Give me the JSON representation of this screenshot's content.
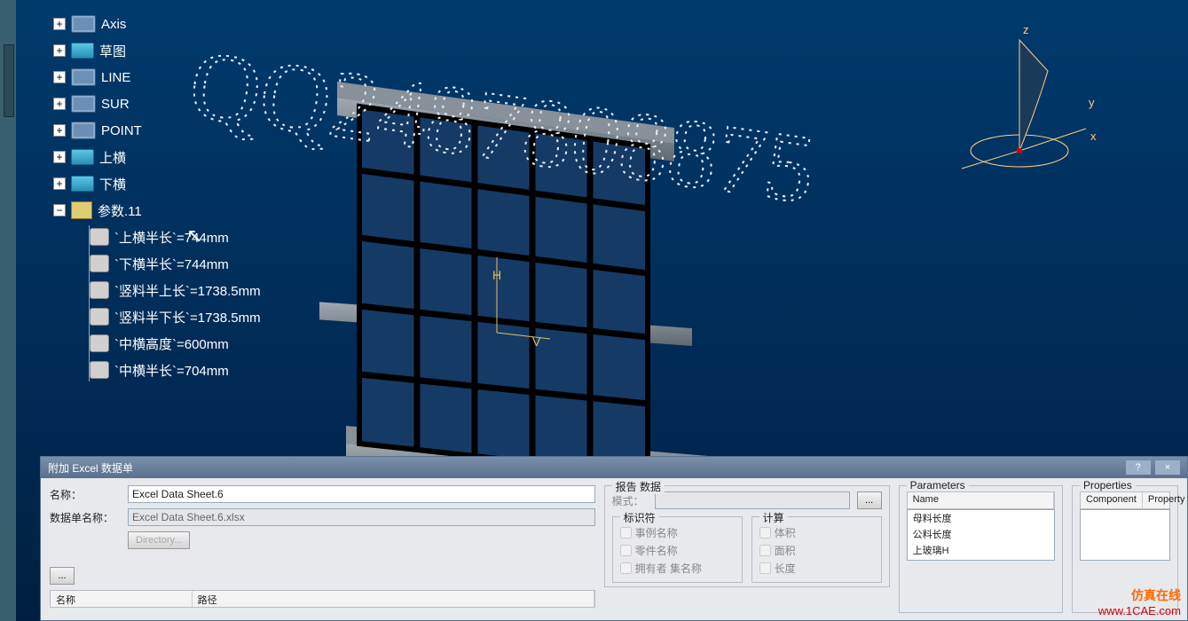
{
  "tree": {
    "items": [
      {
        "exp": "+",
        "icon": "cube",
        "label": "Axis"
      },
      {
        "exp": "+",
        "icon": "fold",
        "label": "草图"
      },
      {
        "exp": "+",
        "icon": "cube",
        "label": "LINE"
      },
      {
        "exp": "+",
        "icon": "cube",
        "label": "SUR"
      },
      {
        "exp": "+",
        "icon": "cube",
        "label": "POINT"
      },
      {
        "exp": "+",
        "icon": "fold",
        "label": "上横"
      },
      {
        "exp": "+",
        "icon": "fold",
        "label": "下横"
      },
      {
        "exp": "−",
        "icon": "prm",
        "label": "参数.11"
      }
    ],
    "params": [
      "`上横半长`=744mm",
      "`下横半长`=744mm",
      "`竖料半上长`=1738.5mm",
      "`竖料半下长`=1738.5mm",
      "`中横高度`=600mm",
      "`中横半长`=704mm"
    ]
  },
  "compass": {
    "axes": [
      "x",
      "y",
      "z"
    ]
  },
  "watermark_text": "QQ2487808875",
  "dialog": {
    "title": "附加 Excel 数据单",
    "controls": [
      "?",
      "×"
    ],
    "name_label": "名称：",
    "name_value": "Excel Data Sheet.6",
    "sheet_label": "数据单名称：",
    "sheet_value": "Excel Data Sheet.6.xlsx",
    "directory_btn": "Directory...",
    "table_headers": [
      "名称",
      "路径"
    ],
    "report_title": "报告 数据",
    "mode_label": "模式：",
    "identifier_title": "标识符",
    "identifier_options": [
      "事例名称",
      "零件名称",
      "拥有者 集名称"
    ],
    "compute_title": "计算",
    "compute_options": [
      "体积",
      "面积",
      "长度"
    ],
    "parameters_title": "Parameters",
    "param_list_header": "Name",
    "param_list": [
      "母料长度",
      "公料长度",
      "上玻璃H"
    ],
    "properties_title": "Properties",
    "prop_headers": [
      "Component",
      "Property"
    ],
    "dots": "..."
  },
  "site_watermark": {
    "line1": "仿真在线",
    "line2": "www.1CAE.com"
  }
}
